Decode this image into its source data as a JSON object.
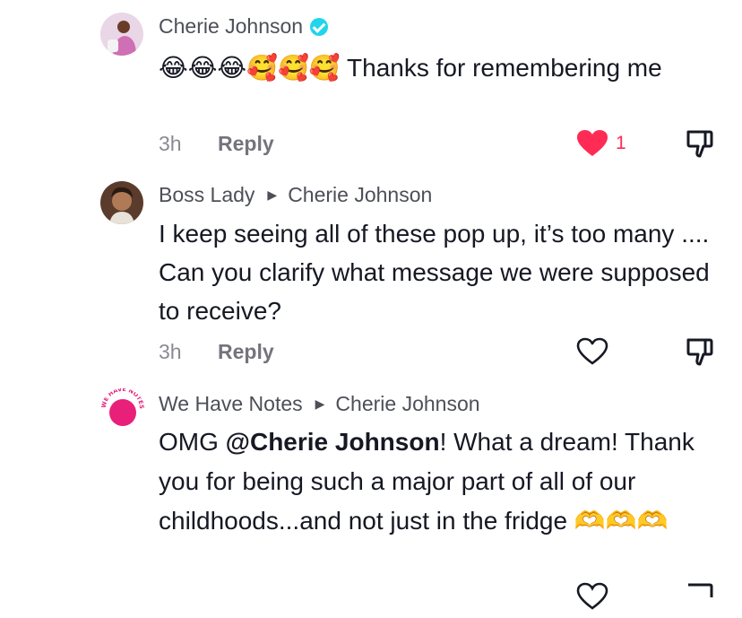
{
  "comments": [
    {
      "author": "Cherie Johnson",
      "verified": true,
      "reply_to": "",
      "text_emoji": "😂😂😂🥰🥰🥰",
      "text": " Thanks for remembering me",
      "time": "3h",
      "reply_label": "Reply",
      "liked": true,
      "like_count": "1",
      "avatar_icon": "profile-photo"
    },
    {
      "author": "Boss Lady",
      "reply_to": "Cherie Johnson",
      "text": "I keep seeing all of these pop up, it’s too many .... Can you clarify what message we were supposed to receive?",
      "time": "3h",
      "reply_label": "Reply",
      "liked": false,
      "avatar_icon": "profile-photo"
    },
    {
      "author": "We Have Notes",
      "reply_to": "Cherie Johnson",
      "text_pre": "OMG ",
      "mention": "@Cherie Johnson",
      "text_post": "! What a dream! Thank you for being such a major part of all of our childhoods...and not just in the fridge ",
      "text_emoji": "🫶🫶🫶",
      "avatar_logo_text": "WE HAVE NOTES",
      "avatar_icon": "brand-logo"
    }
  ],
  "colors": {
    "like_red": "#fe2c55",
    "verified_blue": "#20d5ec",
    "logo_pink": "#e8207a"
  }
}
